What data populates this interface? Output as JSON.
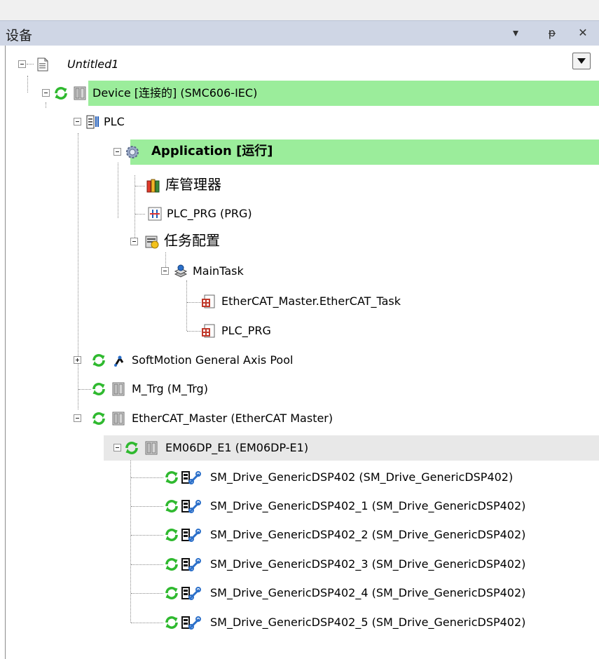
{
  "panel": {
    "title": "设备",
    "menu_glyph": "▾",
    "pin_glyph": "ᵽ",
    "close_glyph": "✕"
  },
  "colors": {
    "header_bg": "#cfd6e5",
    "online_highlight": "#9bed9b",
    "selected_highlight": "#e8e8e8",
    "status_green": "#2fb92f"
  },
  "tree": {
    "root": "Untitled1",
    "device": "Device [连接的] (SMC606-IEC)",
    "plc": "PLC",
    "application": "Application [运行]",
    "library_manager": "库管理器",
    "plc_prg": "PLC_PRG (PRG)",
    "task_config": "任务配置",
    "main_task": "MainTask",
    "ethercat_task": "EtherCAT_Master.EtherCAT_Task",
    "plc_prg_call": "PLC_PRG",
    "axis_pool": "SoftMotion General Axis Pool",
    "m_trg": "M_Trg (M_Trg)",
    "ethercat_master": "EtherCAT_Master (EtherCAT Master)",
    "em06dp": "EM06DP_E1 (EM06DP-E1)",
    "drives": [
      "SM_Drive_GenericDSP402 (SM_Drive_GenericDSP402)",
      "SM_Drive_GenericDSP402_1 (SM_Drive_GenericDSP402)",
      "SM_Drive_GenericDSP402_2 (SM_Drive_GenericDSP402)",
      "SM_Drive_GenericDSP402_3 (SM_Drive_GenericDSP402)",
      "SM_Drive_GenericDSP402_4 (SM_Drive_GenericDSP402)",
      "SM_Drive_GenericDSP402_5 (SM_Drive_GenericDSP402)"
    ]
  }
}
